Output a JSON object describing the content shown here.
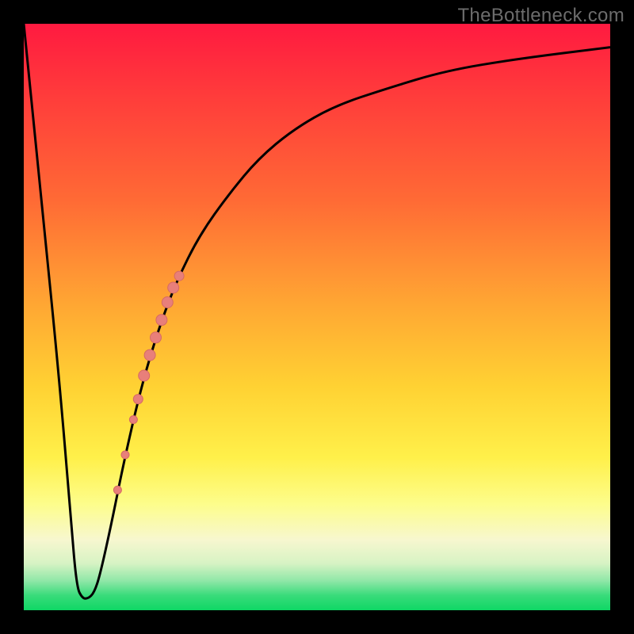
{
  "watermark": "TheBottleneck.com",
  "colors": {
    "background": "#000000",
    "curve": "#000000",
    "marker_fill": "#e87f7a",
    "marker_stroke": "#d66a64",
    "gradient_top": "#ff1a40",
    "gradient_bottom": "#0fd765"
  },
  "chart_data": {
    "type": "line",
    "title": "",
    "xlabel": "",
    "ylabel": "",
    "xlim": [
      0,
      100
    ],
    "ylim": [
      0,
      100
    ],
    "grid": false,
    "legend": false,
    "series": [
      {
        "name": "bottleneck-curve",
        "x": [
          0,
          3,
          6,
          8,
          9,
          10,
          11,
          12,
          13,
          15,
          17,
          20,
          23,
          26,
          30,
          35,
          40,
          46,
          53,
          62,
          72,
          84,
          100
        ],
        "y": [
          100,
          70,
          40,
          16,
          4,
          2,
          2,
          3,
          6,
          15,
          25,
          38,
          48,
          56,
          64,
          71,
          77,
          82,
          86,
          89,
          92,
          94,
          96
        ]
      }
    ],
    "markers": [
      {
        "x": 16.0,
        "y": 20.5,
        "r": 5
      },
      {
        "x": 17.3,
        "y": 26.5,
        "r": 5
      },
      {
        "x": 18.7,
        "y": 32.5,
        "r": 5
      },
      {
        "x": 19.5,
        "y": 36.0,
        "r": 6
      },
      {
        "x": 20.5,
        "y": 40.0,
        "r": 7
      },
      {
        "x": 21.5,
        "y": 43.5,
        "r": 7
      },
      {
        "x": 22.5,
        "y": 46.5,
        "r": 7
      },
      {
        "x": 23.5,
        "y": 49.5,
        "r": 7
      },
      {
        "x": 24.5,
        "y": 52.5,
        "r": 7
      },
      {
        "x": 25.5,
        "y": 55.0,
        "r": 7
      },
      {
        "x": 26.5,
        "y": 57.0,
        "r": 6
      }
    ]
  }
}
